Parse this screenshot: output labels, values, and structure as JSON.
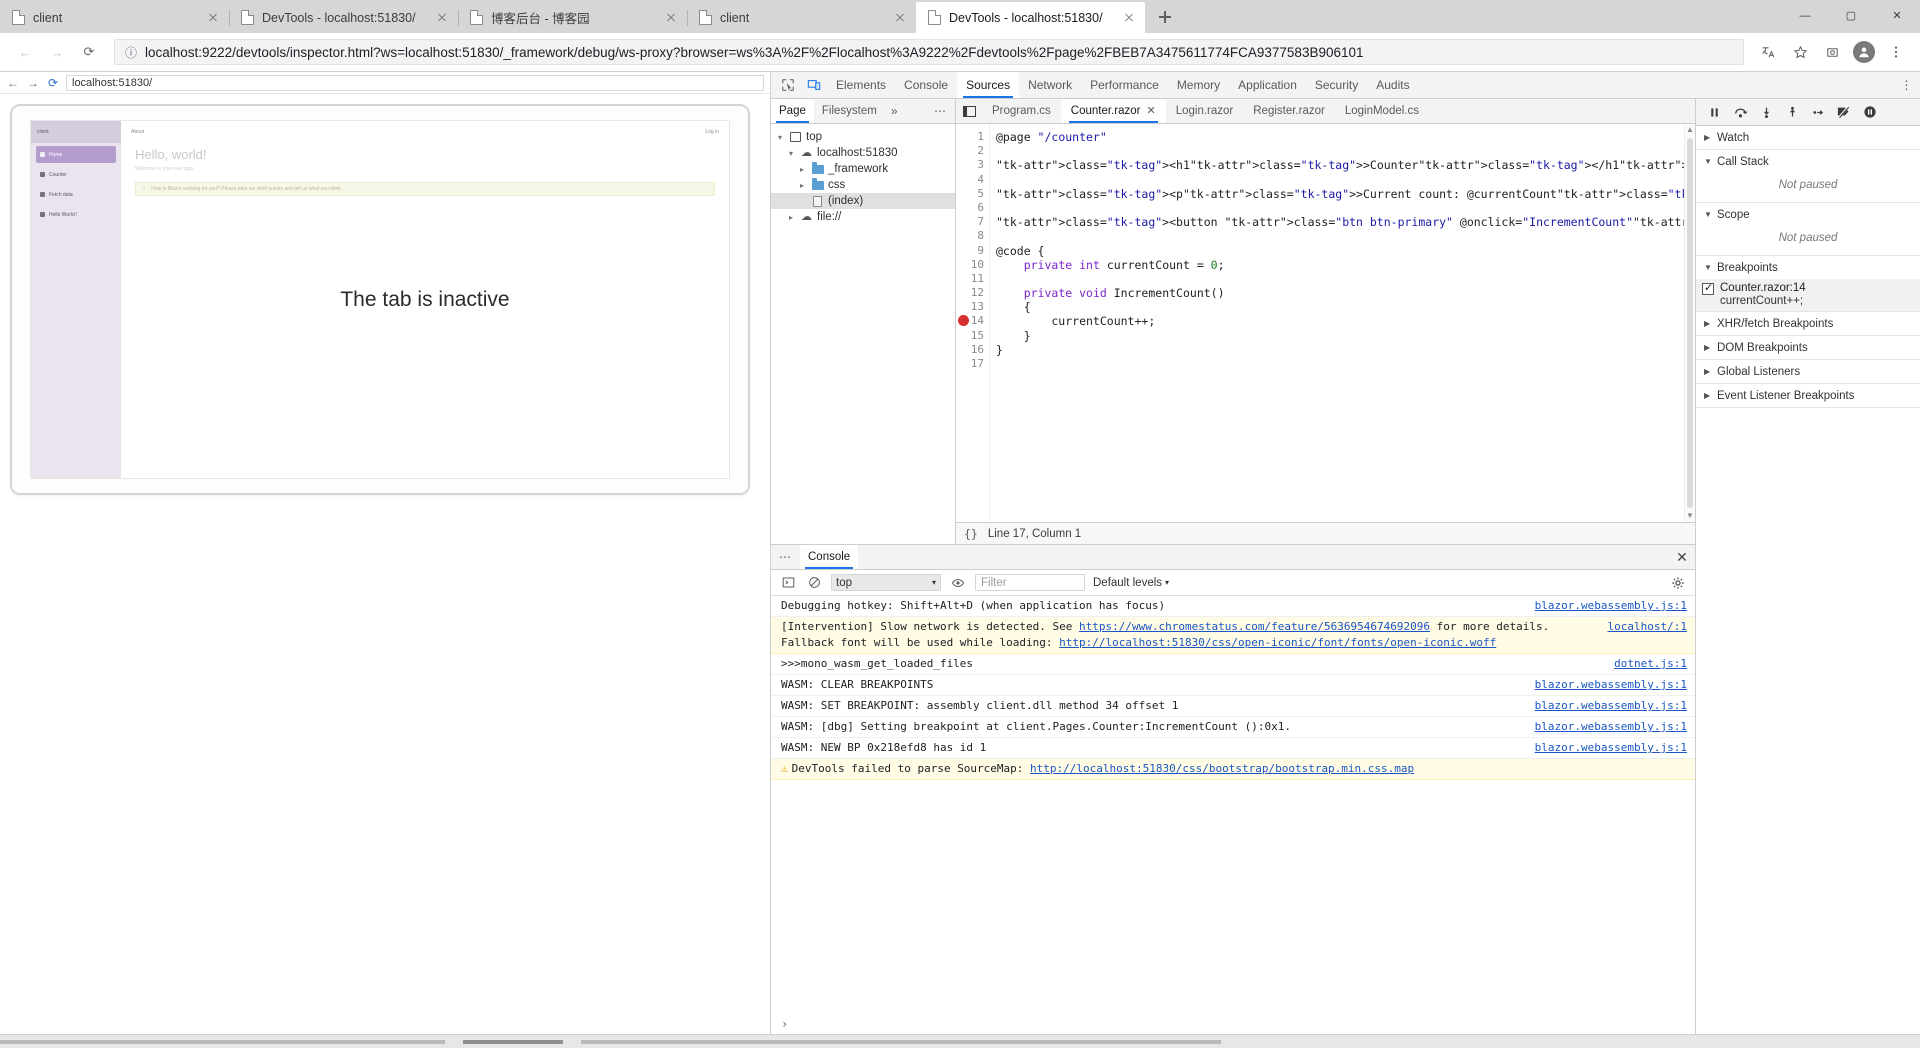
{
  "browser": {
    "tabs": [
      {
        "title": "client",
        "active": false
      },
      {
        "title": "DevTools - localhost:51830/",
        "active": false
      },
      {
        "title": "博客后台 - 博客园",
        "active": false
      },
      {
        "title": "client",
        "active": false
      },
      {
        "title": "DevTools - localhost:51830/",
        "active": true
      }
    ],
    "new_tab_label": "+",
    "window_controls": {
      "minimize": "—",
      "maximize": "▢",
      "close": "✕"
    },
    "omnibox": {
      "url": "localhost:9222/devtools/inspector.html?ws=localhost:51830/_framework/debug/ws-proxy?browser=ws%3A%2F%2Flocalhost%3A9222%2Fdevtools%2Fpage%2FBEB7A3475611774FCA9377583B906101",
      "info_icon": "ⓘ"
    },
    "nav": {
      "back": "←",
      "forward": "→",
      "reload": "⟳"
    },
    "toolbar_icons": [
      "translate-icon",
      "star-icon",
      "extensions-icon",
      "profile-avatar",
      "menu-icon"
    ]
  },
  "render_pane": {
    "nav": {
      "back": "←",
      "forward": "→",
      "reload": "⟳"
    },
    "url": "localhost:51830/",
    "inactive_message": "The tab is inactive",
    "blazor": {
      "brand": "client",
      "nav_items": [
        {
          "label": "Home",
          "selected": true
        },
        {
          "label": "Counter",
          "selected": false
        },
        {
          "label": "Fetch data",
          "selected": false
        },
        {
          "label": "Hello World !",
          "selected": false
        }
      ],
      "topbar_left": "About",
      "topbar_right": "Log in",
      "heading": "Hello, world!",
      "subheading": "Welcome to your new app.",
      "alert": "How is Blazor working for you? Please take our brief survey and tell us what you think."
    }
  },
  "devtools": {
    "panel_tabs": [
      {
        "label": "Elements",
        "active": false
      },
      {
        "label": "Console",
        "active": false
      },
      {
        "label": "Sources",
        "active": true
      },
      {
        "label": "Network",
        "active": false
      },
      {
        "label": "Performance",
        "active": false
      },
      {
        "label": "Memory",
        "active": false
      },
      {
        "label": "Application",
        "active": false
      },
      {
        "label": "Security",
        "active": false
      },
      {
        "label": "Audits",
        "active": false
      }
    ],
    "left_icons": [
      "inspect-element-icon",
      "device-toolbar-icon"
    ],
    "more_label": "⋮",
    "navigator": {
      "tabs": [
        {
          "label": "Page",
          "active": true
        },
        {
          "label": "Filesystem",
          "active": false
        }
      ],
      "chevron": "»",
      "more": "⋯",
      "tree": [
        {
          "label": "top",
          "depth": 0,
          "icon": "frame-icon",
          "twisty": "▾",
          "selected": false
        },
        {
          "label": "localhost:51830",
          "depth": 1,
          "icon": "cloud-icon",
          "twisty": "▾",
          "selected": false
        },
        {
          "label": "_framework",
          "depth": 2,
          "icon": "folder-icon",
          "twisty": "▸",
          "selected": false
        },
        {
          "label": "css",
          "depth": 2,
          "icon": "folder-icon",
          "twisty": "▸",
          "selected": false
        },
        {
          "label": "(index)",
          "depth": 2,
          "icon": "file-icon",
          "twisty": "",
          "selected": true
        },
        {
          "label": "file://",
          "depth": 1,
          "icon": "cloud-icon",
          "twisty": "▸",
          "selected": false
        }
      ]
    },
    "editor": {
      "collapse_icon": "collapse-sidebar-icon",
      "tabs": [
        {
          "label": "Program.cs",
          "active": false,
          "closable": false
        },
        {
          "label": "Counter.razor",
          "active": true,
          "closable": true
        },
        {
          "label": "Login.razor",
          "active": false,
          "closable": false
        },
        {
          "label": "Register.razor",
          "active": false,
          "closable": false
        },
        {
          "label": "LoginModel.cs",
          "active": false,
          "closable": false
        }
      ],
      "close_glyph": "✕",
      "breakpoint_line": 14,
      "lines": [
        {
          "n": 1,
          "text": "@page \"/counter\""
        },
        {
          "n": 2,
          "text": ""
        },
        {
          "n": 3,
          "text": "<h1>Counter</h1>"
        },
        {
          "n": 4,
          "text": ""
        },
        {
          "n": 5,
          "text": "<p>Current count: @currentCount</p>"
        },
        {
          "n": 6,
          "text": ""
        },
        {
          "n": 7,
          "text": "<button class=\"btn btn-primary\" @onclick=\"IncrementCount\">Click me</button>"
        },
        {
          "n": 8,
          "text": ""
        },
        {
          "n": 9,
          "text": "@code {"
        },
        {
          "n": 10,
          "text": "    private int currentCount = 0;"
        },
        {
          "n": 11,
          "text": ""
        },
        {
          "n": 12,
          "text": "    private void IncrementCount()"
        },
        {
          "n": 13,
          "text": "    {"
        },
        {
          "n": 14,
          "text": "        currentCount++;"
        },
        {
          "n": 15,
          "text": "    }"
        },
        {
          "n": 16,
          "text": "}"
        },
        {
          "n": 17,
          "text": ""
        }
      ],
      "status": "Line 17, Column 1",
      "format_button": "{}"
    },
    "debugger": {
      "toolbar_buttons": [
        {
          "name": "pause-resume-button",
          "glyph": "❚❚"
        },
        {
          "name": "step-over-button",
          "glyph": "⤻"
        },
        {
          "name": "step-into-button",
          "glyph": "⤓"
        },
        {
          "name": "step-out-button",
          "glyph": "⤒"
        },
        {
          "name": "step-button",
          "glyph": "→|"
        },
        {
          "name": "deactivate-breakpoints-button",
          "glyph": "🚫"
        },
        {
          "name": "pause-on-exceptions-button",
          "glyph": "⏸"
        }
      ],
      "sections": [
        {
          "title": "Watch",
          "expanded": false,
          "body": null
        },
        {
          "title": "Call Stack",
          "expanded": true,
          "body": "Not paused"
        },
        {
          "title": "Scope",
          "expanded": true,
          "body": "Not paused"
        },
        {
          "title": "Breakpoints",
          "expanded": true,
          "body": null
        },
        {
          "title": "XHR/fetch Breakpoints",
          "expanded": false,
          "body": null
        },
        {
          "title": "DOM Breakpoints",
          "expanded": false,
          "body": null
        },
        {
          "title": "Global Listeners",
          "expanded": false,
          "body": null
        },
        {
          "title": "Event Listener Breakpoints",
          "expanded": false,
          "body": null
        }
      ],
      "breakpoint": {
        "checked": true,
        "location": "Counter.razor:14",
        "snippet": "currentCount++;"
      }
    },
    "drawer": {
      "more": "⋯",
      "tabs": [
        {
          "label": "Console",
          "active": true
        }
      ],
      "close": "✕",
      "toolbar": {
        "execute_icon": "sidebar-toggle-icon",
        "clear_icon": "clear-console-icon",
        "context": "top",
        "context_caret": "▾",
        "eye_icon": "live-expression-icon",
        "filter_placeholder": "Filter",
        "levels": "Default levels",
        "levels_caret": "▾",
        "settings_icon": "gear-icon"
      },
      "log": [
        {
          "level": "log",
          "parts": [
            {
              "t": "text",
              "v": "Debugging hotkey: Shift+Alt+D (when application has focus)"
            }
          ],
          "source": "blazor.webassembly.js:1"
        },
        {
          "level": "warn",
          "parts": [
            {
              "t": "text",
              "v": "[Intervention] Slow network is detected. See "
            },
            {
              "t": "link",
              "v": "https://www.chromestatus.com/feature/5636954674692096"
            },
            {
              "t": "text",
              "v": " for more details. Fallback font will be used while loading: "
            },
            {
              "t": "link",
              "v": "http://localhost:51830/css/open-iconic/font/fonts/open-iconic.woff"
            }
          ],
          "source": "localhost/:1"
        },
        {
          "level": "log",
          "parts": [
            {
              "t": "text",
              "v": ">>>mono_wasm_get_loaded_files"
            }
          ],
          "source": "dotnet.js:1"
        },
        {
          "level": "log",
          "parts": [
            {
              "t": "text",
              "v": "WASM: CLEAR BREAKPOINTS"
            }
          ],
          "source": "blazor.webassembly.js:1"
        },
        {
          "level": "log",
          "parts": [
            {
              "t": "text",
              "v": "WASM: SET BREAKPOINT: assembly client.dll method 34 offset 1"
            }
          ],
          "source": "blazor.webassembly.js:1"
        },
        {
          "level": "log",
          "parts": [
            {
              "t": "text",
              "v": "WASM: [dbg] Setting breakpoint at client.Pages.Counter:IncrementCount ():0x1."
            }
          ],
          "source": "blazor.webassembly.js:1"
        },
        {
          "level": "log",
          "parts": [
            {
              "t": "text",
              "v": "WASM: NEW BP 0x218efd8 has id 1"
            }
          ],
          "source": "blazor.webassembly.js:1"
        },
        {
          "level": "warn",
          "icon": "⚠",
          "parts": [
            {
              "t": "text",
              "v": "DevTools failed to parse SourceMap: "
            },
            {
              "t": "link",
              "v": "http://localhost:51830/css/bootstrap/bootstrap.min.css.map"
            }
          ],
          "source": ""
        }
      ],
      "prompt": "›"
    }
  },
  "colors": {
    "accent": "#1a73e8",
    "breakpoint": "#d8302f",
    "warn_bg": "#fffbe5",
    "link": "#1a56c4",
    "folder": "#5a9fd4"
  }
}
